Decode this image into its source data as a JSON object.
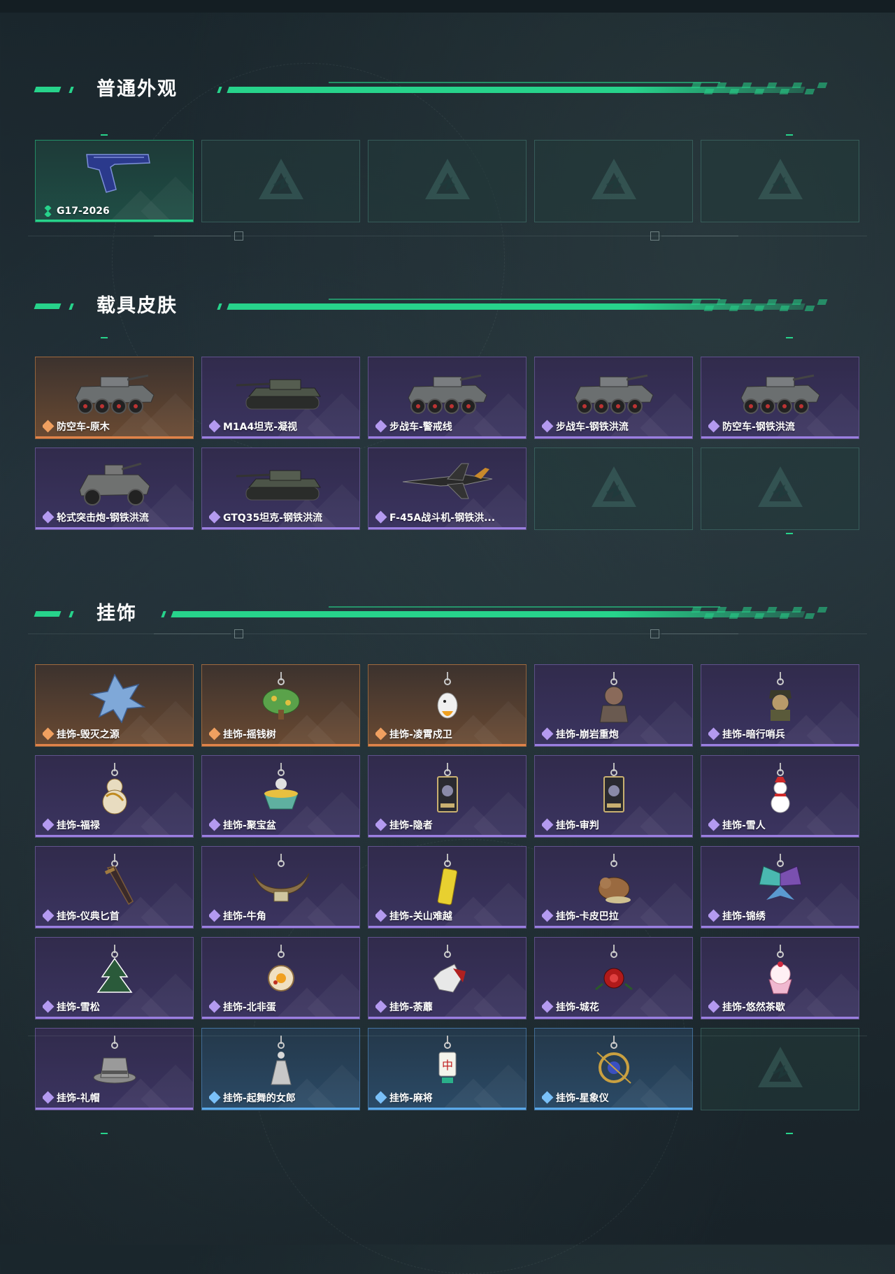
{
  "sections": {
    "normal": {
      "title": "普通外观"
    },
    "vehicle": {
      "title": "载具皮肤"
    },
    "charm": {
      "title": "挂饰"
    }
  },
  "normal_items": [
    {
      "name": "G17-2026",
      "rarity": "green",
      "icon": "pistol-icon"
    }
  ],
  "vehicle_items": [
    {
      "name": "防空车-原木",
      "rarity": "orange",
      "icon": "wheeled-vehicle-icon"
    },
    {
      "name": "M1A4坦克-凝视",
      "rarity": "purple",
      "icon": "tank-icon"
    },
    {
      "name": "步战车-警戒线",
      "rarity": "purple",
      "icon": "wheeled-vehicle-icon"
    },
    {
      "name": "步战车-钢铁洪流",
      "rarity": "purple",
      "icon": "wheeled-vehicle-icon"
    },
    {
      "name": "防空车-钢铁洪流",
      "rarity": "purple",
      "icon": "wheeled-vehicle-icon"
    },
    {
      "name": "轮式突击炮-钢铁洪流",
      "rarity": "purple",
      "icon": "armored-car-icon"
    },
    {
      "name": "GTQ35坦克-钢铁洪流",
      "rarity": "purple",
      "icon": "tank-icon"
    },
    {
      "name": "F-45A战斗机-钢铁洪...",
      "rarity": "purple",
      "icon": "jet-icon"
    }
  ],
  "charm_items": [
    {
      "name": "挂饰-毁灭之源",
      "rarity": "orange",
      "icon": "dragon-charm-icon"
    },
    {
      "name": "挂饰-摇钱树",
      "rarity": "orange",
      "icon": "tree-charm-icon"
    },
    {
      "name": "挂饰-凌霄戍卫",
      "rarity": "orange",
      "icon": "chick-charm-icon"
    },
    {
      "name": "挂饰-崩岩重炮",
      "rarity": "purple",
      "icon": "figure-charm-icon"
    },
    {
      "name": "挂饰-暗行哨兵",
      "rarity": "purple",
      "icon": "soldier-charm-icon"
    },
    {
      "name": "挂饰-福禄",
      "rarity": "purple",
      "icon": "gourd-charm-icon"
    },
    {
      "name": "挂饰-聚宝盆",
      "rarity": "purple",
      "icon": "treasure-bowl-charm-icon"
    },
    {
      "name": "挂饰-隐者",
      "rarity": "purple",
      "icon": "card-charm-icon"
    },
    {
      "name": "挂饰-审判",
      "rarity": "purple",
      "icon": "card-charm-icon"
    },
    {
      "name": "挂饰-雪人",
      "rarity": "purple",
      "icon": "snowman-charm-icon"
    },
    {
      "name": "挂饰-仪典匕首",
      "rarity": "purple",
      "icon": "dagger-charm-icon"
    },
    {
      "name": "挂饰-牛角",
      "rarity": "purple",
      "icon": "horns-charm-icon"
    },
    {
      "name": "挂饰-关山难越",
      "rarity": "purple",
      "icon": "bottle-charm-icon"
    },
    {
      "name": "挂饰-卡皮巴拉",
      "rarity": "purple",
      "icon": "capybara-charm-icon"
    },
    {
      "name": "挂饰-锦绣",
      "rarity": "purple",
      "icon": "butterfly-charm-icon"
    },
    {
      "name": "挂饰-雪松",
      "rarity": "purple",
      "icon": "pine-tree-charm-icon"
    },
    {
      "name": "挂饰-北非蛋",
      "rarity": "purple",
      "icon": "egg-pan-charm-icon"
    },
    {
      "name": "挂饰-荼蘼",
      "rarity": "purple",
      "icon": "flower-charm-icon"
    },
    {
      "name": "挂饰-城花",
      "rarity": "purple",
      "icon": "rose-charm-icon"
    },
    {
      "name": "挂饰-悠然茶歇",
      "rarity": "purple",
      "icon": "cupcake-charm-icon"
    },
    {
      "name": "挂饰-礼帽",
      "rarity": "purple",
      "icon": "hat-charm-icon"
    },
    {
      "name": "挂饰-起舞的女郎",
      "rarity": "blue",
      "icon": "dancer-charm-icon"
    },
    {
      "name": "挂饰-麻将",
      "rarity": "blue",
      "icon": "mahjong-charm-icon"
    },
    {
      "name": "挂饰-星象仪",
      "rarity": "blue",
      "icon": "astrolabe-charm-icon"
    }
  ],
  "colors": {
    "accent": "#27d38b",
    "purple": "#9a7fe0",
    "orange": "#e0834a",
    "blue": "#5aa8e8"
  }
}
